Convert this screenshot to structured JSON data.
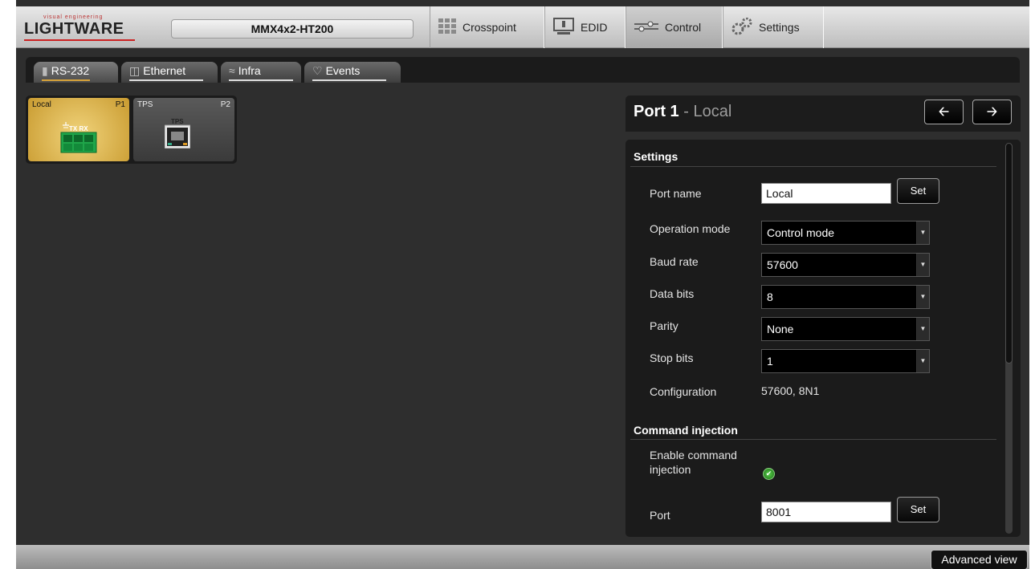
{
  "app": {
    "logo_tagline": "visual engineering",
    "logo_text": "LIGHTWARE",
    "device_name": "MMX4x2-HT200"
  },
  "nav": {
    "tabs": [
      {
        "label": "Crosspoint",
        "icon": "grid-icon"
      },
      {
        "label": "EDID",
        "icon": "monitor-icon"
      },
      {
        "label": "Control",
        "icon": "slider-icon",
        "active": true
      },
      {
        "label": "Settings",
        "icon": "gear-icon"
      }
    ]
  },
  "subtabs": [
    {
      "label": "RS-232",
      "icon": "serial-icon",
      "active": true
    },
    {
      "label": "Ethernet",
      "icon": "ethernet-icon"
    },
    {
      "label": "Infra",
      "icon": "wifi-icon"
    },
    {
      "label": "Events",
      "icon": "events-icon"
    }
  ],
  "ports": [
    {
      "label": "Local",
      "id": "P1",
      "connector": "TX RX",
      "selected": true
    },
    {
      "label": "TPS",
      "id": "P2",
      "connector": "TPS"
    }
  ],
  "panel": {
    "title_bold": "Port 1",
    "title_sep": " - ",
    "title_sub": "Local",
    "prev_icon": "arrow-left-icon",
    "next_icon": "arrow-right-icon",
    "settings": {
      "section_title": "Settings",
      "port_name_label": "Port name",
      "port_name_value": "Local",
      "set_label": "Set",
      "operation_mode_label": "Operation mode",
      "operation_mode_value": "Control mode",
      "baud_rate_label": "Baud rate",
      "baud_rate_value": "57600",
      "data_bits_label": "Data bits",
      "data_bits_value": "8",
      "parity_label": "Parity",
      "parity_value": "None",
      "stop_bits_label": "Stop bits",
      "stop_bits_value": "1",
      "configuration_label": "Configuration",
      "configuration_value": "57600, 8N1"
    },
    "command_injection": {
      "section_title": "Command injection",
      "enable_label_line1": "Enable command",
      "enable_label_line2": "injection",
      "enabled": true,
      "port_label": "Port",
      "port_value": "8001",
      "set_label": "Set"
    }
  },
  "footer": {
    "advanced_view_label": "Advanced view"
  },
  "colors": {
    "accent": "#d6a23a",
    "background": "#2e2e2e",
    "panel": "#1b1b1b"
  }
}
